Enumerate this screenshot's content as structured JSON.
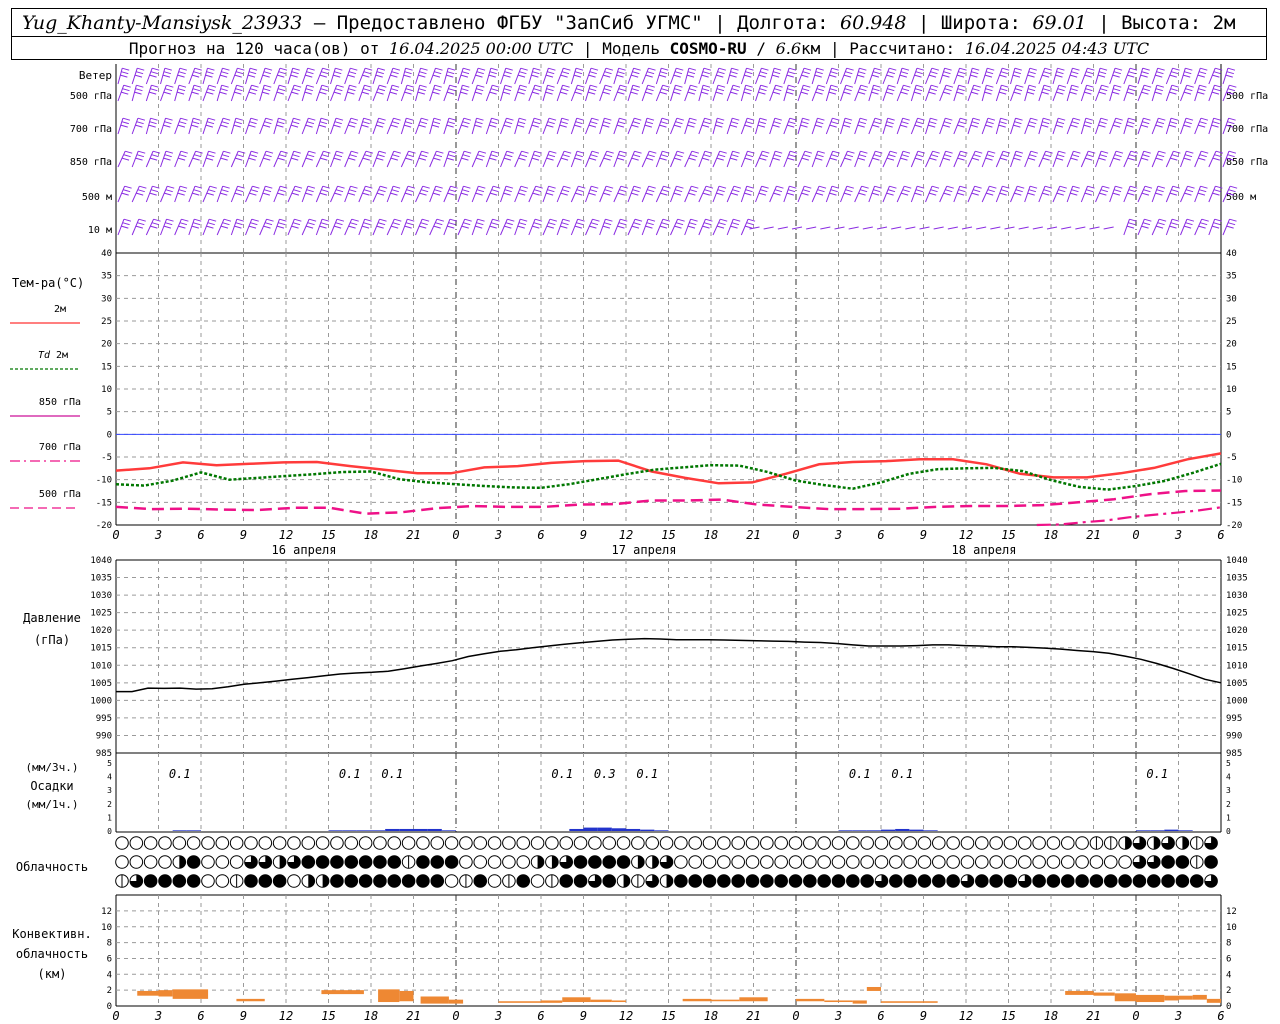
{
  "header": {
    "station": "Yug_Khanty-Mansiysk_23933",
    "dash": " – ",
    "provider": "Предоставлено ФГБУ \"ЗапСиб УГМС\"",
    "lon_label": "Долгота: ",
    "lon_value": "60.948",
    "lat_label": "Широта: ",
    "lat_value": "69.01",
    "alt_label": "Высота: ",
    "alt_value": "2м",
    "sep": " | ",
    "forecast_prefix": "Прогноз на 120 часа(ов) от ",
    "forecast_start": "16.04.2025 00:00 UTC",
    "model_label": "Модель ",
    "model_name": "COSMO-RU",
    "model_res": "6.6",
    "model_res_unit": "км",
    "calc_label": "Рассчитано: ",
    "calc_time": "16.04.2025 04:43 UTC"
  },
  "panels": {
    "wind": {
      "title": "Ветер",
      "levels": [
        "500 гПа",
        "700 гПа",
        "850 гПа",
        "500 м",
        "10  м"
      ]
    },
    "temperature": {
      "title": "Тем-ра(°C)",
      "legend": [
        {
          "label": "2м",
          "color": "#ff3333",
          "style": "solid"
        },
        {
          "label_italic": "Td",
          "label": "2м",
          "color": "#007700",
          "style": "dotted"
        },
        {
          "label": "850 гПа",
          "color": "#cc1199",
          "style": "solid-thin"
        },
        {
          "label": "700 гПа",
          "color": "#ee1188",
          "style": "dashdot"
        },
        {
          "label": "500 гПа",
          "color": "#ee1188",
          "style": "dashed"
        }
      ],
      "ylim": [
        -20,
        40
      ],
      "ticks": [
        "40",
        "35",
        "30",
        "25",
        "20",
        "15",
        "10",
        "5",
        "0",
        "-5",
        "-10",
        "-15",
        "-20"
      ]
    },
    "x_axis": {
      "hour_labels": [
        "0",
        "3",
        "6",
        "9",
        "12",
        "15",
        "18",
        "21",
        "0",
        "3",
        "6",
        "9",
        "12",
        "15",
        "18",
        "21",
        "0",
        "3",
        "6",
        "9",
        "12",
        "15",
        "18",
        "21",
        "0",
        "3",
        "6"
      ],
      "day_labels": [
        "16 апреля",
        "17 апреля",
        "18 апреля"
      ]
    },
    "pressure": {
      "title": "Давление",
      "unit": "(гПа)",
      "ylim": [
        985,
        1040
      ],
      "ticks": [
        "1040",
        "1035",
        "1030",
        "1025",
        "1020",
        "1015",
        "1010",
        "1005",
        "1000",
        "995",
        "990",
        "985"
      ]
    },
    "precip": {
      "unit_top": "(мм/3ч.)",
      "title": "Осадки",
      "unit_bottom": "(мм/1ч.)",
      "ticks": [
        "5",
        "4",
        "3",
        "2",
        "1",
        "0"
      ],
      "labels": [
        {
          "h": 4.5,
          "text": "0.1"
        },
        {
          "h": 16.5,
          "text": "0.1"
        },
        {
          "h": 19.5,
          "text": "0.1"
        },
        {
          "h": 31.5,
          "text": "0.1"
        },
        {
          "h": 34.5,
          "text": "0.3"
        },
        {
          "h": 37.5,
          "text": "0.1"
        },
        {
          "h": 52.5,
          "text": "0.1"
        },
        {
          "h": 55.5,
          "text": "0.1"
        },
        {
          "h": 73.5,
          "text": "0.1"
        }
      ]
    },
    "cloud": {
      "title": "Облачность"
    },
    "convective": {
      "title1": "Конвективн.",
      "title2": "облачность",
      "unit": "(км)",
      "ticks": [
        "12",
        "10",
        "8",
        "6",
        "4",
        "2",
        "0"
      ]
    }
  },
  "chart_data": [
    {
      "type": "line",
      "title": "Тем-ра(°C)",
      "x_hours": [
        0,
        3,
        6,
        9,
        12,
        15,
        18,
        21,
        24,
        27,
        30,
        33,
        36,
        39,
        42,
        45,
        48,
        51,
        54,
        57,
        60,
        63,
        66,
        69,
        72,
        75,
        78
      ],
      "series": [
        {
          "name": "2м",
          "values": [
            -8,
            -7.5,
            -6.2,
            -6.8,
            -6.5,
            -6.2,
            -6.1,
            -7,
            -7.8,
            -8.6,
            -8.6,
            -7.3,
            -7,
            -6.3,
            -5.9,
            -5.8,
            -8.2,
            -9.6,
            -10.8,
            -10.6,
            -8.7,
            -6.6,
            -6.1,
            -5.9,
            -5.5,
            -5.5,
            -6.6,
            -8.7,
            -9.5,
            -9.5,
            -8.6,
            -7.4,
            -5.5,
            -4.2
          ]
        },
        {
          "name": "Td 2м",
          "values": [
            -11,
            -11.3,
            -10.2,
            -8.4,
            -10,
            -9.6,
            -9.2,
            -8.8,
            -8.3,
            -8.2,
            -9.9,
            -10.6,
            -11,
            -11.4,
            -11.7,
            -11.8,
            -11,
            -9.9,
            -8.8,
            -7.8,
            -7.3,
            -6.8,
            -6.9,
            -8.3,
            -10.2,
            -11.2,
            -12,
            -10.6,
            -8.7,
            -7.7,
            -7.5,
            -7.4,
            -8.1,
            -10.1,
            -11.6,
            -12.2,
            -11.4,
            -10.3,
            -8.5,
            -6.5
          ]
        },
        {
          "name": "500 гПа",
          "values": [
            -16,
            -16.5,
            -16.4,
            -16.6,
            -16.7,
            -16.2,
            -16.2,
            -17.5,
            -17.2,
            -16.3,
            -15.8,
            -16,
            -16,
            -15.5,
            -15.4,
            -14.6,
            -14.6,
            -14.4,
            -15.5,
            -16,
            -16.5,
            -16.5,
            -16.4,
            -16,
            -15.8,
            -15.8,
            -15.6,
            -15,
            -14.3,
            -13.2,
            -12.5,
            -12.4
          ]
        },
        {
          "name": "700 гПа",
          "values": [
            -20,
            -19.9,
            -19.4,
            -19,
            -18.3,
            -17.8,
            -17.3,
            -16.8,
            -16.1
          ]
        }
      ],
      "ylim": [
        -20,
        40
      ]
    },
    {
      "type": "line",
      "title": "Давление",
      "ylabel": "(гПа)",
      "x_hours": [
        0,
        1,
        2,
        3,
        4,
        5,
        6,
        7,
        8,
        9,
        10,
        11,
        12,
        13,
        14,
        15,
        16,
        17,
        18,
        19,
        20,
        21,
        22,
        23,
        24,
        25,
        26,
        27,
        28,
        29,
        30,
        31,
        32,
        33,
        34,
        35,
        36,
        37,
        38,
        39,
        40,
        41,
        42,
        43,
        44,
        45,
        46,
        47,
        48,
        49,
        50,
        51,
        52,
        53,
        54,
        55,
        56,
        57,
        58,
        59,
        60,
        61,
        62,
        63,
        64,
        65,
        66,
        67,
        68,
        69,
        70,
        71,
        72,
        73,
        74,
        75,
        76,
        77,
        78
      ],
      "values": [
        1002.5,
        1002.5,
        1003.5,
        1003.4,
        1003.5,
        1003.2,
        1003.3,
        1003.9,
        1004.6,
        1005,
        1005.5,
        1006,
        1006.5,
        1007,
        1007.5,
        1007.8,
        1008,
        1008.3,
        1009,
        1009.8,
        1010.5,
        1011.3,
        1012.5,
        1013.3,
        1014,
        1014.4,
        1015,
        1015.5,
        1016,
        1016.4,
        1016.8,
        1017.2,
        1017.4,
        1017.6,
        1017.5,
        1017.3,
        1017.3,
        1017.3,
        1017.2,
        1017.1,
        1017,
        1016.9,
        1016.8,
        1016.6,
        1016.5,
        1016.2,
        1015.8,
        1015.5,
        1015.5,
        1015.5,
        1015.6,
        1015.8,
        1015.8,
        1015.6,
        1015.5,
        1015.3,
        1015.3,
        1015.1,
        1014.9,
        1014.6,
        1014.2,
        1013.9,
        1013.4,
        1012.6,
        1011.7,
        1010.5,
        1009.1,
        1007.6,
        1006,
        1005
      ]
    },
    {
      "type": "bar",
      "title": "Осадки",
      "note": "mm per 1h",
      "x_hours": [
        4,
        5,
        15,
        16,
        17,
        18,
        19,
        20,
        21,
        22,
        23,
        32,
        33,
        34,
        35,
        36,
        37,
        38,
        51,
        52,
        53,
        54,
        55,
        56,
        57,
        72,
        73,
        74,
        75
      ],
      "values": [
        0.05,
        0.05,
        0.05,
        0.05,
        0.05,
        0.05,
        0.15,
        0.15,
        0.15,
        0.15,
        0.05,
        0.15,
        0.25,
        0.25,
        0.2,
        0.15,
        0.1,
        0.05,
        0.05,
        0.05,
        0.05,
        0.1,
        0.15,
        0.1,
        0.05,
        0.05,
        0.05,
        0.1,
        0.05
      ]
    },
    {
      "type": "table",
      "title": "Облачность",
      "note": "cloud cover symbols per hour (0=clear,1=quarter,2=half,3=three-quarter,4=overcast); rows: high, middle, low",
      "x_hours_start": 0,
      "x_hours_end": 78,
      "rows": [
        [
          0,
          0,
          0,
          0,
          0,
          0,
          0,
          0,
          0,
          0,
          0,
          0,
          0,
          0,
          0,
          0,
          0,
          0,
          0,
          0,
          0,
          0,
          0,
          0,
          0,
          0,
          0,
          0,
          0,
          0,
          0,
          0,
          0,
          0,
          0,
          0,
          0,
          0,
          0,
          0,
          0,
          0,
          0,
          0,
          0,
          0,
          0,
          0,
          0,
          0,
          0,
          0,
          0,
          0,
          0,
          0,
          0,
          0,
          0,
          0,
          0,
          0,
          0,
          0,
          0,
          0,
          0,
          0,
          1,
          1,
          2,
          3,
          2,
          3,
          2,
          1,
          3,
          4,
          4,
          4
        ],
        [
          0,
          0,
          0,
          0,
          2,
          4,
          0,
          0,
          0,
          3,
          3,
          2,
          3,
          4,
          4,
          4,
          4,
          4,
          4,
          4,
          1,
          4,
          4,
          4,
          0,
          0,
          0,
          0,
          0,
          2,
          2,
          3,
          4,
          4,
          4,
          4,
          2,
          2,
          3,
          0,
          0,
          0,
          0,
          0,
          0,
          0,
          0,
          0,
          0,
          0,
          0,
          0,
          0,
          0,
          0,
          0,
          0,
          0,
          0,
          0,
          0,
          0,
          0,
          0,
          0,
          0,
          0,
          0,
          0,
          0,
          0,
          3,
          3,
          4,
          4,
          1,
          4,
          4,
          4,
          4
        ],
        [
          1,
          3,
          4,
          4,
          4,
          4,
          0,
          0,
          1,
          4,
          4,
          4,
          0,
          2,
          2,
          4,
          4,
          4,
          4,
          4,
          4,
          4,
          4,
          0,
          1,
          4,
          0,
          1,
          4,
          0,
          1,
          4,
          4,
          3,
          4,
          2,
          1,
          3,
          2,
          4,
          4,
          4,
          4,
          4,
          4,
          4,
          4,
          4,
          4,
          4,
          4,
          4,
          4,
          3,
          4,
          4,
          4,
          4,
          4,
          3,
          4,
          4,
          4,
          3,
          4,
          4,
          4,
          4,
          4,
          4,
          4,
          4,
          4,
          4,
          4,
          4,
          3,
          3,
          4,
          4
        ]
      ]
    },
    {
      "type": "bar",
      "title": "Конвективн. облачность",
      "ylabel": "(км)",
      "ylim": [
        0,
        13
      ],
      "bars": [
        {
          "x0": 1.5,
          "x1": 3,
          "base": 1.3,
          "top": 1.9
        },
        {
          "x0": 3,
          "x1": 4,
          "base": 1.2,
          "top": 2.0
        },
        {
          "x0": 4,
          "x1": 6.5,
          "base": 0.9,
          "top": 2.1
        },
        {
          "x0": 8.5,
          "x1": 10.5,
          "base": 0.6,
          "top": 0.9
        },
        {
          "x0": 14.5,
          "x1": 17.5,
          "base": 1.5,
          "top": 2.0
        },
        {
          "x0": 18.5,
          "x1": 20,
          "base": 0.5,
          "top": 2.1
        },
        {
          "x0": 20,
          "x1": 21,
          "base": 0.6,
          "top": 1.9
        },
        {
          "x0": 21.5,
          "x1": 23.5,
          "base": 0.3,
          "top": 1.2
        },
        {
          "x0": 23.5,
          "x1": 24.5,
          "base": 0.3,
          "top": 0.8
        },
        {
          "x0": 27,
          "x1": 30,
          "base": 0.4,
          "top": 0.6
        },
        {
          "x0": 30,
          "x1": 31.5,
          "base": 0.4,
          "top": 0.7
        },
        {
          "x0": 31.5,
          "x1": 33.5,
          "base": 0.5,
          "top": 1.1
        },
        {
          "x0": 33.5,
          "x1": 35,
          "base": 0.5,
          "top": 0.8
        },
        {
          "x0": 35,
          "x1": 36,
          "base": 0.5,
          "top": 0.7
        },
        {
          "x0": 40,
          "x1": 42,
          "base": 0.6,
          "top": 0.9
        },
        {
          "x0": 42,
          "x1": 44,
          "base": 0.6,
          "top": 0.8
        },
        {
          "x0": 44,
          "x1": 46,
          "base": 0.6,
          "top": 1.1
        },
        {
          "x0": 48,
          "x1": 50,
          "base": 0.6,
          "top": 0.9
        },
        {
          "x0": 50,
          "x1": 52,
          "base": 0.5,
          "top": 0.7
        },
        {
          "x0": 52,
          "x1": 53,
          "base": 0.3,
          "top": 0.7
        },
        {
          "x0": 53,
          "x1": 54,
          "base": 1.9,
          "top": 2.4
        },
        {
          "x0": 54,
          "x1": 58,
          "base": 0.4,
          "top": 0.6
        },
        {
          "x0": 67,
          "x1": 69,
          "base": 1.4,
          "top": 1.9
        },
        {
          "x0": 69,
          "x1": 70.5,
          "base": 1.3,
          "top": 1.7
        },
        {
          "x0": 70.5,
          "x1": 72,
          "base": 0.6,
          "top": 1.6
        },
        {
          "x0": 72,
          "x1": 74,
          "base": 0.5,
          "top": 1.4
        },
        {
          "x0": 74,
          "x1": 75,
          "base": 0.7,
          "top": 1.3
        },
        {
          "x0": 75,
          "x1": 76,
          "base": 0.8,
          "top": 1.3
        },
        {
          "x0": 76,
          "x1": 77,
          "base": 0.8,
          "top": 1.4
        },
        {
          "x0": 77,
          "x1": 78,
          "base": 0.4,
          "top": 0.9
        }
      ]
    }
  ]
}
